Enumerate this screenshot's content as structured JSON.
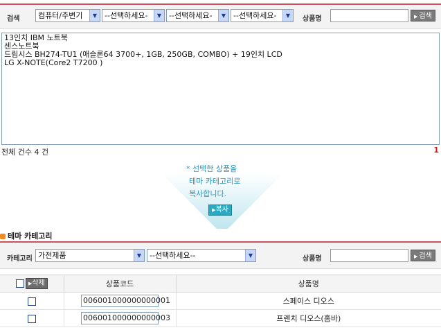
{
  "search": {
    "label": "검색",
    "category1": "컴퓨터/주변기",
    "category2": "--선택하세요-",
    "category3": "--선택하세요-",
    "category4": "--선택하세요-",
    "name_label": "상품명",
    "name_value": "",
    "search_button": "검색"
  },
  "products": [
    "13인치 IBM 노트북",
    "센스노트북",
    "드림시스 BH274-TU1 (애슬론64 3700+, 1GB, 250GB, COMBO) + 19인치 LCD",
    "LG X-NOTE(Core2 T7200 )"
  ],
  "total": "전체 건수 4 건",
  "page": "1",
  "copy": {
    "line1": "* 선택한 상품을",
    "line2": "테마 카테고리로",
    "line3": "복사합니다.",
    "button": "복사"
  },
  "theme": {
    "title": "테마 카테고리",
    "category_label": "카테고리",
    "category1": "가전제품",
    "category2": "--선택하세요--",
    "name_label": "상품명",
    "name_value": "",
    "search_button": "검색"
  },
  "table": {
    "delete_button": "삭제",
    "col_code": "상품코드",
    "col_name": "상품명",
    "rows": [
      {
        "code": "006001000000000001",
        "name": "스페이스 디오스"
      },
      {
        "code": "006001000000000003",
        "name": "프렌치 디오스(홈바)"
      }
    ]
  },
  "colors": {
    "accent_red": "#c9545f",
    "copy_teal": "#2ba9c2",
    "bullet_orange": "#f08a1e"
  }
}
